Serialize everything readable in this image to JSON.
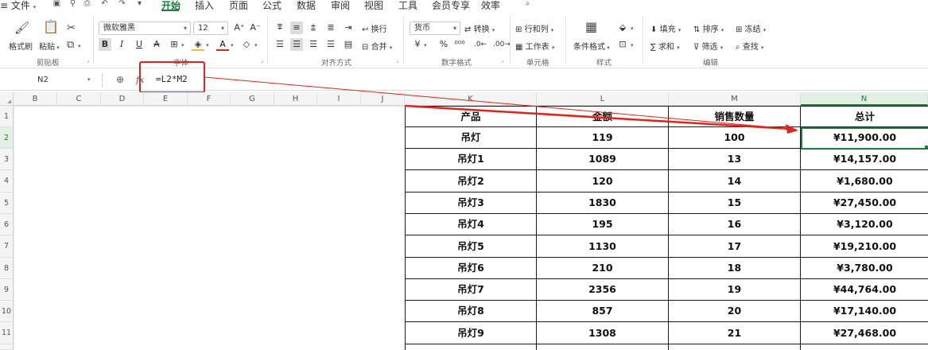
{
  "menubar": {
    "file": "文件",
    "tabs": [
      "开始",
      "插入",
      "页面",
      "公式",
      "数据",
      "审阅",
      "视图",
      "工具",
      "会员专享",
      "效率"
    ],
    "active_tab": "开始"
  },
  "ribbon": {
    "clipboard": {
      "format_painter": "格式刷",
      "paste": "粘贴",
      "group": "剪贴板"
    },
    "font": {
      "name": "微软雅黑",
      "size": "12",
      "group": "字体"
    },
    "alignment": {
      "wrap": "换行",
      "merge": "合并",
      "group": "对齐方式"
    },
    "number": {
      "format": "货币",
      "convert": "转换",
      "group": "数字格式"
    },
    "cells": {
      "rows_cols": "行和列",
      "worksheet": "工作表",
      "group": "单元格"
    },
    "styles": {
      "conditional": "条件格式",
      "group": "样式"
    },
    "editing": {
      "fill": "填充",
      "sort": "排序",
      "freeze": "冻结",
      "sum": "求和",
      "filter": "筛选",
      "find": "查找",
      "group": "编辑"
    }
  },
  "formula_bar": {
    "name_box": "N2",
    "fx": "fx",
    "formula": "=L2*M2"
  },
  "columns": [
    "B",
    "C",
    "D",
    "E",
    "F",
    "G",
    "H",
    "I",
    "J",
    "K",
    "L",
    "M",
    "N"
  ],
  "selected_column": "N",
  "rows": [
    "1",
    "2",
    "3",
    "4",
    "5",
    "6",
    "7",
    "8",
    "9",
    "10",
    "11"
  ],
  "selected_row": "2",
  "table": {
    "headers": [
      "产品",
      "金额",
      "销售数量",
      "总计"
    ],
    "rows": [
      [
        "吊灯",
        "119",
        "100",
        "¥11,900.00"
      ],
      [
        "吊灯1",
        "1089",
        "13",
        "¥14,157.00"
      ],
      [
        "吊灯2",
        "120",
        "14",
        "¥1,680.00"
      ],
      [
        "吊灯3",
        "1830",
        "15",
        "¥27,450.00"
      ],
      [
        "吊灯4",
        "195",
        "16",
        "¥3,120.00"
      ],
      [
        "吊灯5",
        "1130",
        "17",
        "¥19,210.00"
      ],
      [
        "吊灯6",
        "210",
        "18",
        "¥3,780.00"
      ],
      [
        "吊灯7",
        "2356",
        "19",
        "¥44,764.00"
      ],
      [
        "吊灯8",
        "857",
        "20",
        "¥17,140.00"
      ],
      [
        "吊灯9",
        "1308",
        "21",
        "¥27,468.00"
      ]
    ]
  },
  "colors": {
    "accent": "#1b7e3f",
    "annotation": "#e0241b"
  }
}
